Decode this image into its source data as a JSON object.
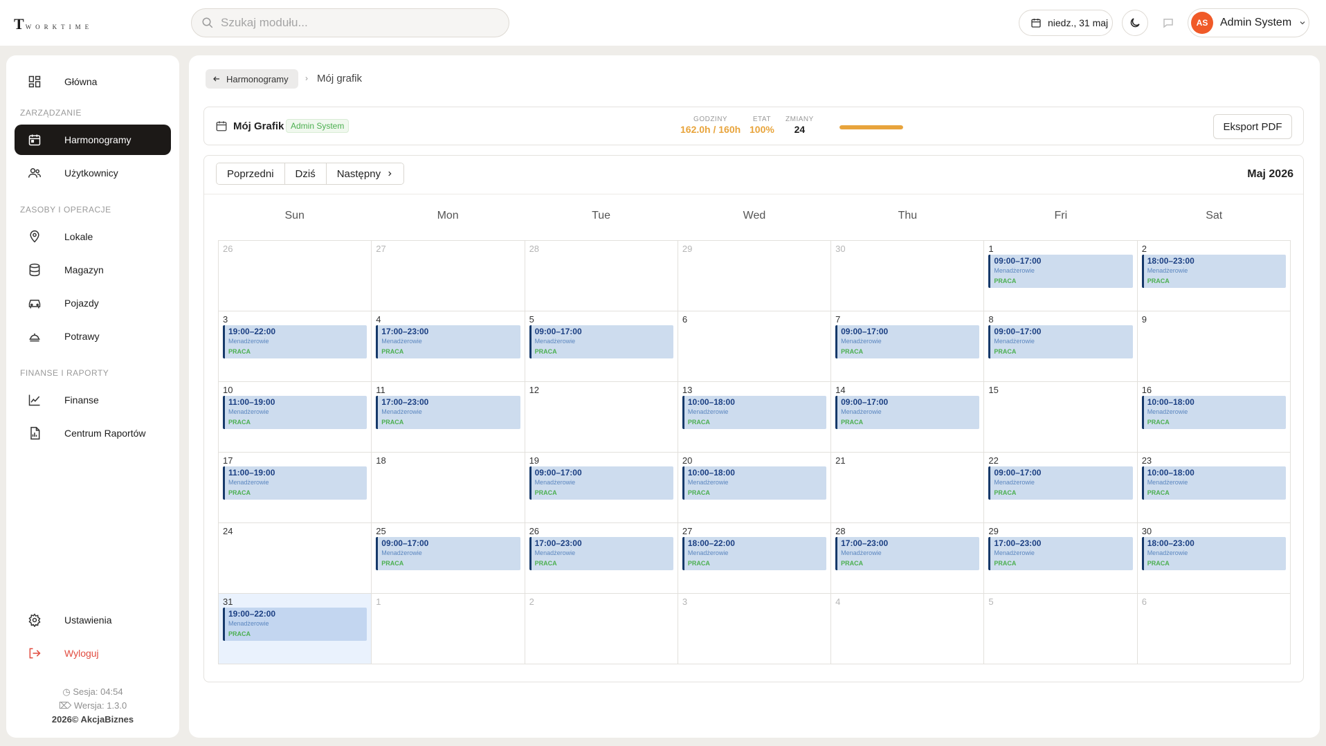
{
  "app": {
    "logo_letter": "T",
    "logo_text": "WORKTIME"
  },
  "search": {
    "placeholder": "Szukaj modułu..."
  },
  "topbar": {
    "date": "niedz., 31 maj",
    "user_initials": "AS",
    "user_name": "Admin System",
    "colors": {
      "avatar": "#f05a28"
    }
  },
  "sidebar": {
    "home_label": "Główna",
    "section_management": "ZARZĄDZANIE",
    "schedules_label": "Harmonogramy",
    "users_label": "Użytkownicy",
    "section_resources": "ZASOBY I OPERACJE",
    "locations_label": "Lokale",
    "warehouse_label": "Magazyn",
    "vehicles_label": "Pojazdy",
    "dishes_label": "Potrawy",
    "section_finance": "FINANSE I RAPORTY",
    "finance_label": "Finanse",
    "reports_label": "Centrum Raportów",
    "settings_label": "Ustawienia",
    "logout_label": "Wyloguj",
    "session": "Sesja: 04:54",
    "version": "Wersja: 1.3.0",
    "copyright": "2026© AkcjaBiznes"
  },
  "breadcrumb": {
    "back_label": "Harmonogramy",
    "separator": "›",
    "current": "Mój grafik"
  },
  "header": {
    "title": "Mój Grafik",
    "badge": "Admin System",
    "hours_label": "GODZINY",
    "hours_value": "162.0h / 160h",
    "etat_label": "ETAT",
    "etat_value": "100%",
    "shifts_label": "ZMIANY",
    "shifts_value": "24",
    "progress_fraction": 1.0,
    "export_label": "Eksport PDF",
    "colors": {
      "hours": "#e8a43c",
      "progress": "#e8a43c"
    }
  },
  "calendar": {
    "prev_label": "Poprzedni",
    "today_label": "Dziś",
    "next_label": "Następny",
    "month_label": "Maj 2026",
    "days_of_week": [
      "Sun",
      "Mon",
      "Tue",
      "Wed",
      "Thu",
      "Fri",
      "Sat"
    ],
    "event_role": "Menadżerowie",
    "event_type": "PRACA",
    "weeks": [
      [
        {
          "day": "26",
          "other": true
        },
        {
          "day": "27",
          "other": true
        },
        {
          "day": "28",
          "other": true
        },
        {
          "day": "29",
          "other": true
        },
        {
          "day": "30",
          "other": true
        },
        {
          "day": "1",
          "event": "09:00–17:00"
        },
        {
          "day": "2",
          "event": "18:00–23:00"
        }
      ],
      [
        {
          "day": "3",
          "event": "19:00–22:00"
        },
        {
          "day": "4",
          "event": "17:00–23:00"
        },
        {
          "day": "5",
          "event": "09:00–17:00"
        },
        {
          "day": "6"
        },
        {
          "day": "7",
          "event": "09:00–17:00"
        },
        {
          "day": "8",
          "event": "09:00–17:00"
        },
        {
          "day": "9"
        }
      ],
      [
        {
          "day": "10",
          "event": "11:00–19:00"
        },
        {
          "day": "11",
          "event": "17:00–23:00"
        },
        {
          "day": "12"
        },
        {
          "day": "13",
          "event": "10:00–18:00"
        },
        {
          "day": "14",
          "event": "09:00–17:00"
        },
        {
          "day": "15"
        },
        {
          "day": "16",
          "event": "10:00–18:00"
        }
      ],
      [
        {
          "day": "17",
          "event": "11:00–19:00"
        },
        {
          "day": "18"
        },
        {
          "day": "19",
          "event": "09:00–17:00"
        },
        {
          "day": "20",
          "event": "10:00–18:00"
        },
        {
          "day": "21"
        },
        {
          "day": "22",
          "event": "09:00–17:00"
        },
        {
          "day": "23",
          "event": "10:00–18:00"
        }
      ],
      [
        {
          "day": "24"
        },
        {
          "day": "25",
          "event": "09:00–17:00"
        },
        {
          "day": "26",
          "event": "17:00–23:00"
        },
        {
          "day": "27",
          "event": "18:00–22:00"
        },
        {
          "day": "28",
          "event": "17:00–23:00"
        },
        {
          "day": "29",
          "event": "17:00–23:00"
        },
        {
          "day": "30",
          "event": "18:00–23:00"
        }
      ],
      [
        {
          "day": "31",
          "event": "19:00–22:00",
          "today": true
        },
        {
          "day": "1",
          "other": true
        },
        {
          "day": "2",
          "other": true
        },
        {
          "day": "3",
          "other": true
        },
        {
          "day": "4",
          "other": true
        },
        {
          "day": "5",
          "other": true
        },
        {
          "day": "6",
          "other": true
        }
      ]
    ],
    "colors": {
      "event_bg": "#cddcee",
      "event_border": "#16396a",
      "event_time": "#1b3f82",
      "event_type": "#4caf50",
      "today_bg": "#eaf2fd"
    }
  }
}
